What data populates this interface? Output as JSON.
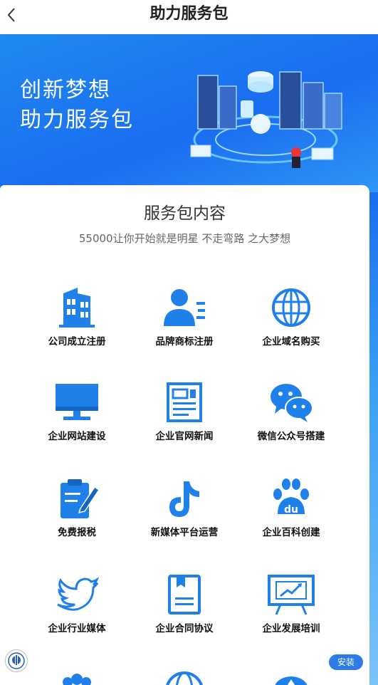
{
  "header": {
    "title": "助力服务包"
  },
  "banner": {
    "line1": "创新梦想",
    "line2": "助力服务包"
  },
  "card": {
    "title": "服务包内容",
    "subtitle": "55000让你开始就是明星 不走弯路 之大梦想",
    "items": [
      {
        "label": "公司成立注册",
        "icon": "building-icon"
      },
      {
        "label": "品牌商标注册",
        "icon": "person-list-icon"
      },
      {
        "label": "企业域名购买",
        "icon": "globe-icon"
      },
      {
        "label": "企业网站建设",
        "icon": "monitor-icon"
      },
      {
        "label": "企业官网新闻",
        "icon": "newspaper-icon"
      },
      {
        "label": "微信公众号搭建",
        "icon": "wechat-icon"
      },
      {
        "label": "免费报税",
        "icon": "clipboard-pen-icon"
      },
      {
        "label": "新媒体平台运营",
        "icon": "tiktok-icon"
      },
      {
        "label": "企业百科创建",
        "icon": "baidu-paw-icon"
      },
      {
        "label": "企业行业媒体",
        "icon": "bird-icon"
      },
      {
        "label": "企业合同协议",
        "icon": "contract-icon"
      },
      {
        "label": "企业发展培训",
        "icon": "presentation-board-icon"
      }
    ]
  },
  "install_button": {
    "label": "安装"
  },
  "colors": {
    "accent": "#2c7be8",
    "banner": "#1a6df0",
    "icon": "#2080ea"
  }
}
